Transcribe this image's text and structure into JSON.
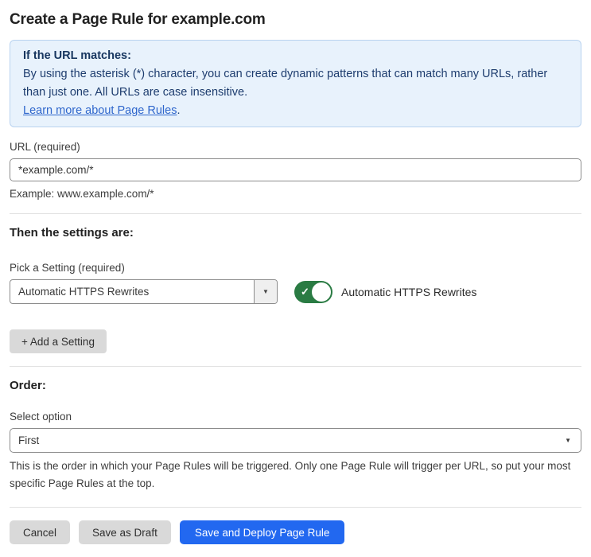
{
  "page": {
    "title": "Create a Page Rule for example.com"
  },
  "info_box": {
    "heading": "If the URL matches:",
    "body": "By using the asterisk (*) character, you can create dynamic patterns that can match many URLs, rather than just one. All URLs are case insensitive.",
    "link_label": "Learn more about Page Rules",
    "link_suffix": "."
  },
  "url_field": {
    "label": "URL (required)",
    "value": "*example.com/*",
    "example": "Example: www.example.com/*"
  },
  "settings_section": {
    "heading": "Then the settings are:",
    "pick_label": "Pick a Setting (required)",
    "selected_setting": "Automatic HTTPS Rewrites",
    "toggle_state": "on",
    "toggle_label": "Automatic HTTPS Rewrites",
    "add_setting_label": "+ Add a Setting"
  },
  "order_section": {
    "heading": "Order:",
    "select_label": "Select option",
    "selected_option": "First",
    "help_text": "This is the order in which your Page Rules will be triggered. Only one Page Rule will trigger per URL, so put your most specific Page Rules at the top."
  },
  "footer": {
    "cancel_label": "Cancel",
    "save_draft_label": "Save as Draft",
    "save_deploy_label": "Save and Deploy Page Rule"
  },
  "icons": {
    "caret_down": "▼",
    "check": "✓"
  },
  "colors": {
    "info_box_bg": "#e8f2fc",
    "info_box_border": "#b9d3f0",
    "info_text": "#1d3c6e",
    "link_blue": "#2e66cc",
    "toggle_green": "#2a7b43",
    "primary_button_blue": "#2268f0",
    "gray_button_bg": "#d9d9d9",
    "input_border": "#8c8c8c"
  }
}
